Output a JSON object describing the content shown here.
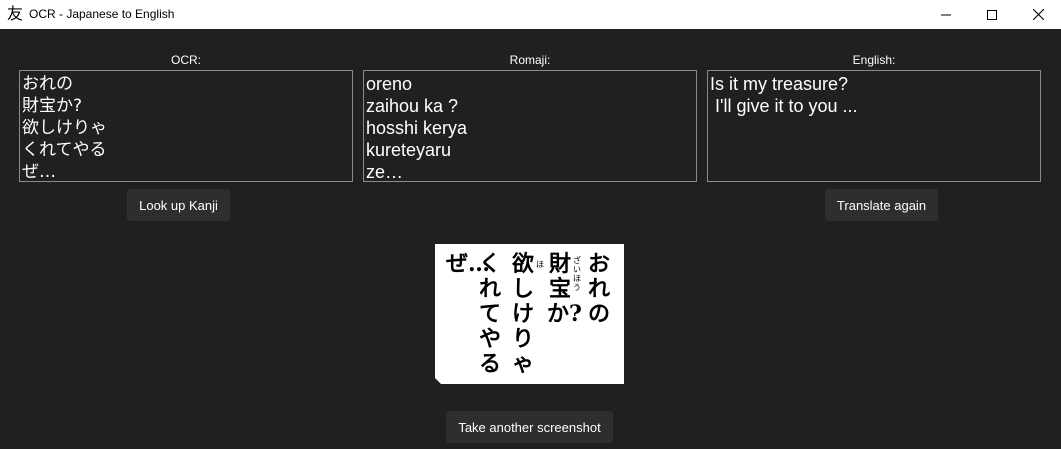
{
  "window": {
    "app_icon_glyph": "友",
    "title": "OCR - Japanese to English"
  },
  "columns": {
    "ocr": {
      "label": "OCR:",
      "lines": [
        "おれの",
        "財宝か?",
        "欲しけりゃ",
        "くれてやる",
        "ぜ…"
      ]
    },
    "romaji": {
      "label": "Romaji:",
      "lines": [
        "oreno",
        "zaihou ka ?",
        "hosshi kerya",
        "kureteyaru",
        "ze…"
      ]
    },
    "english": {
      "label": "English:",
      "lines": [
        "Is it my treasure?",
        " I'll give it to you ..."
      ]
    }
  },
  "buttons": {
    "lookup_kanji": "Look up Kanji",
    "translate_again": "Translate again",
    "take_screenshot": "Take another screenshot"
  },
  "screenshot_preview": {
    "columns": [
      "おれの",
      "財宝か?",
      "欲しけりゃ",
      "くれてやる",
      "ぜ…"
    ],
    "furigana": {
      "zaihou": "ざいほう",
      "hoshi": "ほ"
    }
  }
}
